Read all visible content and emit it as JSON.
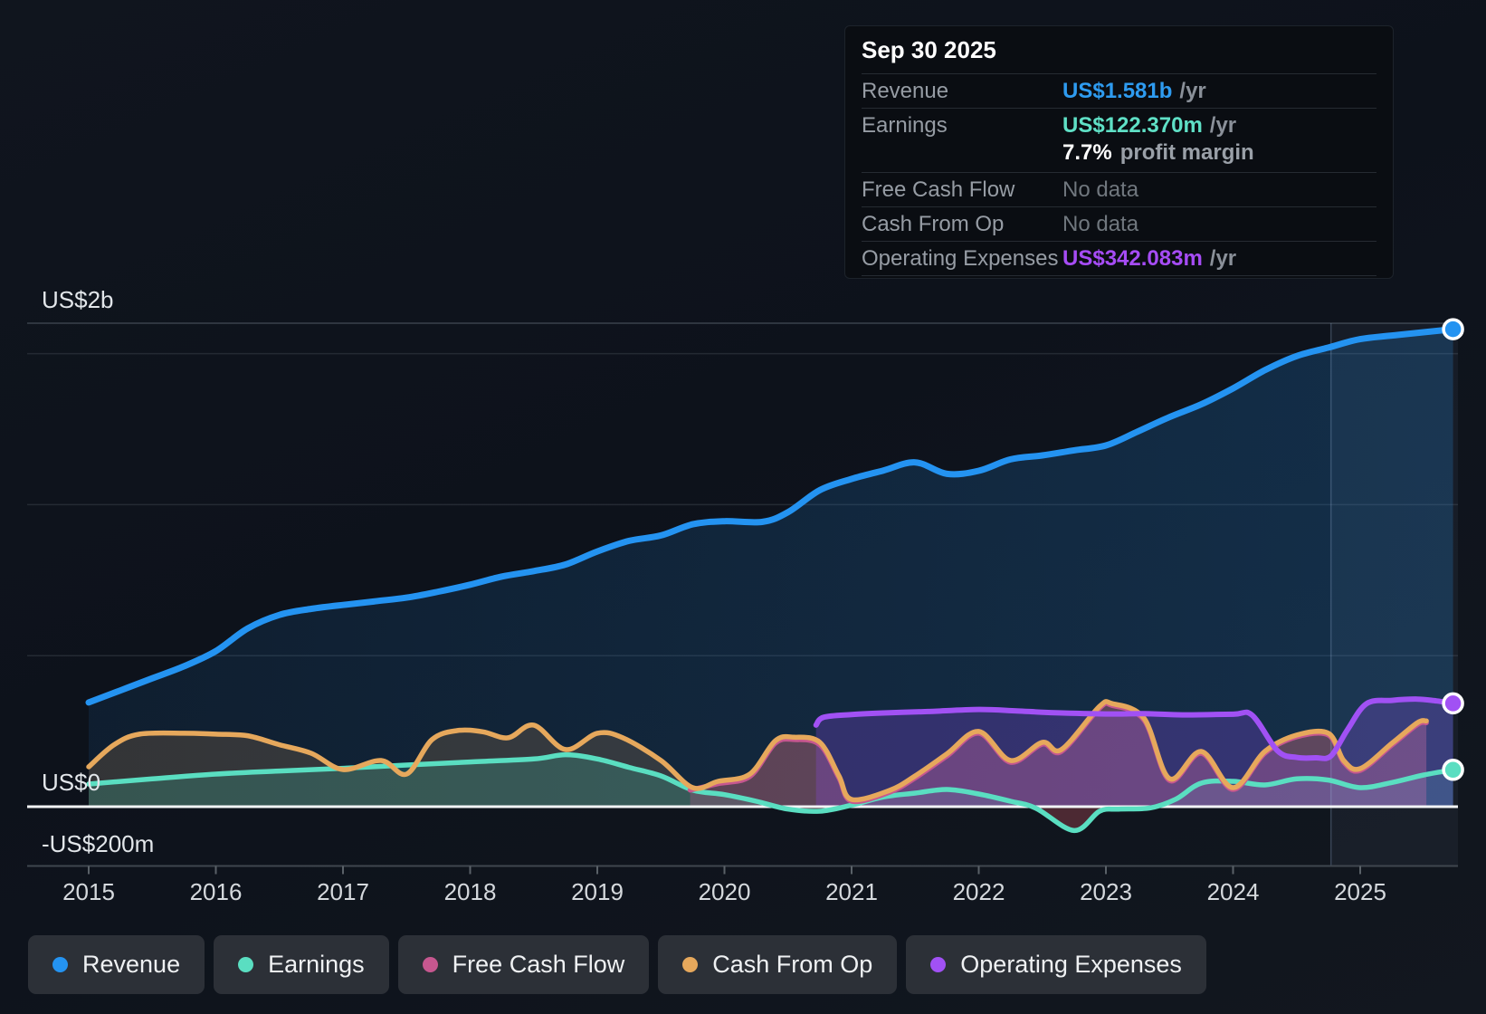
{
  "tooltip": {
    "date": "Sep 30 2025",
    "rows": [
      {
        "label": "Revenue",
        "value": "US$1.581b",
        "suffix": "/yr",
        "color": "#2e9bf0"
      },
      {
        "label": "Earnings",
        "value": "US$122.370m",
        "suffix": "/yr",
        "color": "#5fe0c6",
        "margin_pct": "7.7%",
        "margin_text": "profit margin"
      },
      {
        "label": "Free Cash Flow",
        "value": "No data"
      },
      {
        "label": "Cash From Op",
        "value": "No data"
      },
      {
        "label": "Operating Expenses",
        "value": "US$342.083m",
        "suffix": "/yr",
        "color": "#a64cf5"
      }
    ]
  },
  "chart_data": {
    "type": "area",
    "unit": "US$ millions",
    "x_ticks": [
      2015,
      2016,
      2017,
      2018,
      2019,
      2020,
      2021,
      2022,
      2023,
      2024,
      2025
    ],
    "y_axis_labels": [
      "US$2b",
      "US$0",
      "-US$200m"
    ],
    "ylim": [
      -200,
      2000
    ],
    "grid": true,
    "legend_position": "bottom",
    "highlight_period": {
      "start": 2024.77,
      "end": 2025.77
    },
    "series": [
      {
        "id": "revenue",
        "label": "Revenue",
        "color": "#2493f1",
        "end_value_label": "US$1.581b /yr",
        "points": [
          [
            2015,
            345
          ],
          [
            2015.25,
            385
          ],
          [
            2015.5,
            425
          ],
          [
            2015.75,
            465
          ],
          [
            2016,
            515
          ],
          [
            2016.25,
            590
          ],
          [
            2016.5,
            635
          ],
          [
            2016.75,
            655
          ],
          [
            2017,
            668
          ],
          [
            2017.25,
            680
          ],
          [
            2017.5,
            692
          ],
          [
            2017.75,
            712
          ],
          [
            2018,
            735
          ],
          [
            2018.25,
            762
          ],
          [
            2018.5,
            780
          ],
          [
            2018.75,
            802
          ],
          [
            2019,
            845
          ],
          [
            2019.25,
            880
          ],
          [
            2019.5,
            898
          ],
          [
            2019.75,
            935
          ],
          [
            2020,
            945
          ],
          [
            2020.3,
            943
          ],
          [
            2020.5,
            975
          ],
          [
            2020.75,
            1048
          ],
          [
            2021,
            1085
          ],
          [
            2021.25,
            1113
          ],
          [
            2021.5,
            1140
          ],
          [
            2021.75,
            1102
          ],
          [
            2022,
            1112
          ],
          [
            2022.25,
            1150
          ],
          [
            2022.5,
            1163
          ],
          [
            2022.75,
            1180
          ],
          [
            2023,
            1196
          ],
          [
            2023.25,
            1242
          ],
          [
            2023.5,
            1290
          ],
          [
            2023.75,
            1332
          ],
          [
            2024,
            1385
          ],
          [
            2024.25,
            1445
          ],
          [
            2024.5,
            1492
          ],
          [
            2024.75,
            1520
          ],
          [
            2025,
            1548
          ],
          [
            2025.3,
            1562
          ],
          [
            2025.73,
            1581
          ]
        ]
      },
      {
        "id": "earnings",
        "label": "Earnings",
        "color": "#5adec1",
        "end_value_label": "US$122.370m /yr",
        "points": [
          [
            2015,
            75
          ],
          [
            2015.5,
            92
          ],
          [
            2016,
            108
          ],
          [
            2016.5,
            118
          ],
          [
            2017,
            127
          ],
          [
            2017.5,
            138
          ],
          [
            2018,
            148
          ],
          [
            2018.5,
            158
          ],
          [
            2018.75,
            172
          ],
          [
            2019,
            158
          ],
          [
            2019.25,
            130
          ],
          [
            2019.5,
            102
          ],
          [
            2019.75,
            55
          ],
          [
            2020,
            40
          ],
          [
            2020.25,
            18
          ],
          [
            2020.5,
            -8
          ],
          [
            2020.75,
            -15
          ],
          [
            2021,
            5
          ],
          [
            2021.25,
            32
          ],
          [
            2021.5,
            45
          ],
          [
            2021.75,
            57
          ],
          [
            2022,
            42
          ],
          [
            2022.25,
            18
          ],
          [
            2022.45,
            -5
          ],
          [
            2022.75,
            -79
          ],
          [
            2022.95,
            -15
          ],
          [
            2023.1,
            -8
          ],
          [
            2023.35,
            -4
          ],
          [
            2023.55,
            25
          ],
          [
            2023.75,
            78
          ],
          [
            2024,
            84
          ],
          [
            2024.25,
            72
          ],
          [
            2024.5,
            92
          ],
          [
            2024.75,
            88
          ],
          [
            2025,
            63
          ],
          [
            2025.25,
            80
          ],
          [
            2025.5,
            105
          ],
          [
            2025.73,
            122
          ]
        ]
      },
      {
        "id": "free_cash_flow",
        "label": "Free Cash Flow",
        "color": "#c6578f",
        "end_value_label": "No data",
        "points": [
          [
            2019.73,
            55
          ],
          [
            2019.95,
            76
          ],
          [
            2020.2,
            100
          ],
          [
            2020.4,
            210
          ],
          [
            2020.55,
            222
          ],
          [
            2020.75,
            205
          ],
          [
            2020.9,
            95
          ],
          [
            2021,
            18
          ],
          [
            2021.3,
            48
          ],
          [
            2021.5,
            95
          ],
          [
            2021.75,
            168
          ],
          [
            2022,
            243
          ],
          [
            2022.25,
            147
          ],
          [
            2022.5,
            207
          ],
          [
            2022.65,
            183
          ],
          [
            2022.95,
            326
          ],
          [
            2023.05,
            335
          ],
          [
            2023.3,
            287
          ],
          [
            2023.5,
            87
          ],
          [
            2023.75,
            177
          ],
          [
            2024,
            57
          ],
          [
            2024.25,
            177
          ],
          [
            2024.5,
            231
          ],
          [
            2024.75,
            237
          ],
          [
            2024.87,
            147
          ],
          [
            2025,
            120
          ],
          [
            2025.25,
            204
          ],
          [
            2025.45,
            272
          ],
          [
            2025.52,
            278
          ]
        ]
      },
      {
        "id": "cash_from_op",
        "label": "Cash From Op",
        "color": "#e6a85c",
        "end_value_label": "No data",
        "points": [
          [
            2015,
            132
          ],
          [
            2015.2,
            205
          ],
          [
            2015.4,
            240
          ],
          [
            2015.75,
            243
          ],
          [
            2016,
            240
          ],
          [
            2016.25,
            235
          ],
          [
            2016.5,
            205
          ],
          [
            2016.75,
            177
          ],
          [
            2017,
            123
          ],
          [
            2017.3,
            153
          ],
          [
            2017.5,
            108
          ],
          [
            2017.7,
            222
          ],
          [
            2017.9,
            252
          ],
          [
            2018.1,
            248
          ],
          [
            2018.3,
            228
          ],
          [
            2018.5,
            270
          ],
          [
            2018.75,
            189
          ],
          [
            2019,
            243
          ],
          [
            2019.2,
            228
          ],
          [
            2019.5,
            153
          ],
          [
            2019.75,
            63
          ],
          [
            2019.95,
            84
          ],
          [
            2020.2,
            108
          ],
          [
            2020.4,
            218
          ],
          [
            2020.55,
            230
          ],
          [
            2020.75,
            213
          ],
          [
            2020.9,
            102
          ],
          [
            2021,
            24
          ],
          [
            2021.3,
            54
          ],
          [
            2021.5,
            102
          ],
          [
            2021.75,
            175
          ],
          [
            2022,
            249
          ],
          [
            2022.25,
            153
          ],
          [
            2022.5,
            213
          ],
          [
            2022.65,
            189
          ],
          [
            2022.95,
            332
          ],
          [
            2023.05,
            341
          ],
          [
            2023.3,
            293
          ],
          [
            2023.5,
            93
          ],
          [
            2023.75,
            183
          ],
          [
            2024,
            63
          ],
          [
            2024.25,
            183
          ],
          [
            2024.5,
            237
          ],
          [
            2024.75,
            243
          ],
          [
            2024.87,
            153
          ],
          [
            2025,
            126
          ],
          [
            2025.25,
            210
          ],
          [
            2025.45,
            278
          ],
          [
            2025.52,
            284
          ]
        ]
      },
      {
        "id": "operating_expenses",
        "label": "Operating Expenses",
        "color": "#a151f4",
        "end_value_label": "US$342.083m /yr",
        "points": [
          [
            2020.72,
            270
          ],
          [
            2020.78,
            296
          ],
          [
            2021,
            305
          ],
          [
            2021.3,
            311
          ],
          [
            2021.6,
            315
          ],
          [
            2022,
            322
          ],
          [
            2022.3,
            317
          ],
          [
            2022.6,
            311
          ],
          [
            2023,
            307
          ],
          [
            2023.3,
            308
          ],
          [
            2023.6,
            304
          ],
          [
            2024,
            306
          ],
          [
            2024.15,
            303
          ],
          [
            2024.35,
            185
          ],
          [
            2024.5,
            163
          ],
          [
            2024.65,
            162
          ],
          [
            2024.77,
            168
          ],
          [
            2024.9,
            255
          ],
          [
            2025.05,
            341
          ],
          [
            2025.25,
            352
          ],
          [
            2025.45,
            356
          ],
          [
            2025.6,
            350
          ],
          [
            2025.73,
            342
          ]
        ]
      }
    ]
  },
  "legend": [
    {
      "label": "Revenue",
      "color": "#2493f1"
    },
    {
      "label": "Earnings",
      "color": "#5adec1"
    },
    {
      "label": "Free Cash Flow",
      "color": "#c6578f"
    },
    {
      "label": "Cash From Op",
      "color": "#e6a85c"
    },
    {
      "label": "Operating Expenses",
      "color": "#a151f4"
    }
  ]
}
